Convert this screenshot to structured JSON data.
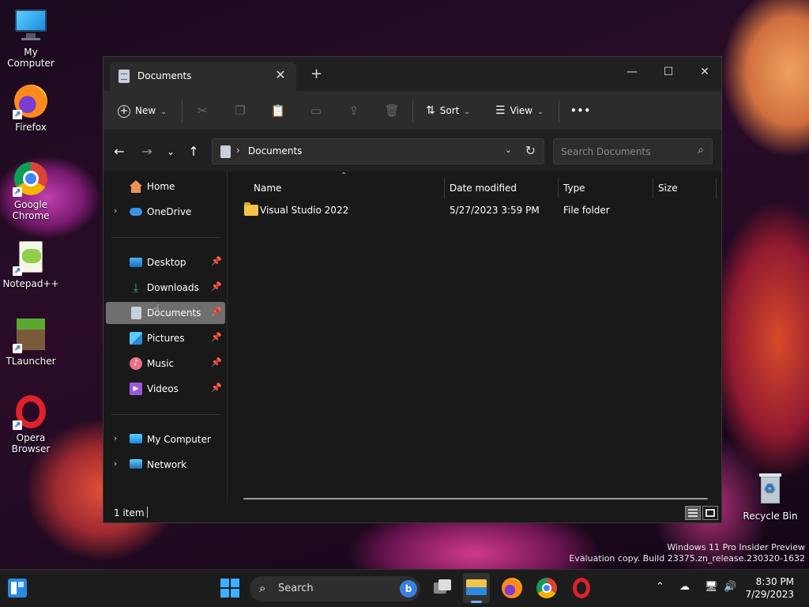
{
  "desktop": {
    "icons": [
      {
        "label": "My Computer"
      },
      {
        "label": "Firefox"
      },
      {
        "label": "Google Chrome"
      },
      {
        "label": "Notepad++"
      },
      {
        "label": "TLauncher"
      },
      {
        "label": "Opera Browser"
      },
      {
        "label": "Recycle Bin"
      }
    ],
    "watermark_line1": "Windows 11 Pro Insider Preview",
    "watermark_line2": "Evaluation copy. Build 23375.zn_release.230320-1632"
  },
  "window": {
    "tab_title": "Documents",
    "tab_close": "✕",
    "new_tab": "+",
    "minimize": "—",
    "maximize": "☐",
    "close": "✕"
  },
  "toolbar": {
    "new_label": "New",
    "sort_label": "Sort",
    "view_label": "View",
    "more_label": "•••"
  },
  "address": {
    "path": "Documents",
    "search_placeholder": "Search Documents"
  },
  "sidebar": {
    "items": [
      {
        "label": "Home"
      },
      {
        "label": "OneDrive"
      },
      {
        "label": "Desktop"
      },
      {
        "label": "Downloads"
      },
      {
        "label": "Documents"
      },
      {
        "label": "Pictures"
      },
      {
        "label": "Music"
      },
      {
        "label": "Videos"
      },
      {
        "label": "My Computer"
      },
      {
        "label": "Network"
      }
    ]
  },
  "content": {
    "columns": {
      "name": "Name",
      "date": "Date modified",
      "type": "Type",
      "size": "Size"
    },
    "rows": [
      {
        "name": "Visual Studio 2022",
        "date": "5/27/2023 3:59 PM",
        "type": "File folder",
        "size": ""
      }
    ]
  },
  "status": {
    "item_count": "1 item"
  },
  "taskbar": {
    "search_label": "Search",
    "time": "8:30 PM",
    "date": "7/29/2023"
  },
  "colors": {
    "accent": "#0078d4",
    "folder": "#f2c54a",
    "window_bg": "#191919",
    "toolbar_bg": "#2c2c2c"
  }
}
